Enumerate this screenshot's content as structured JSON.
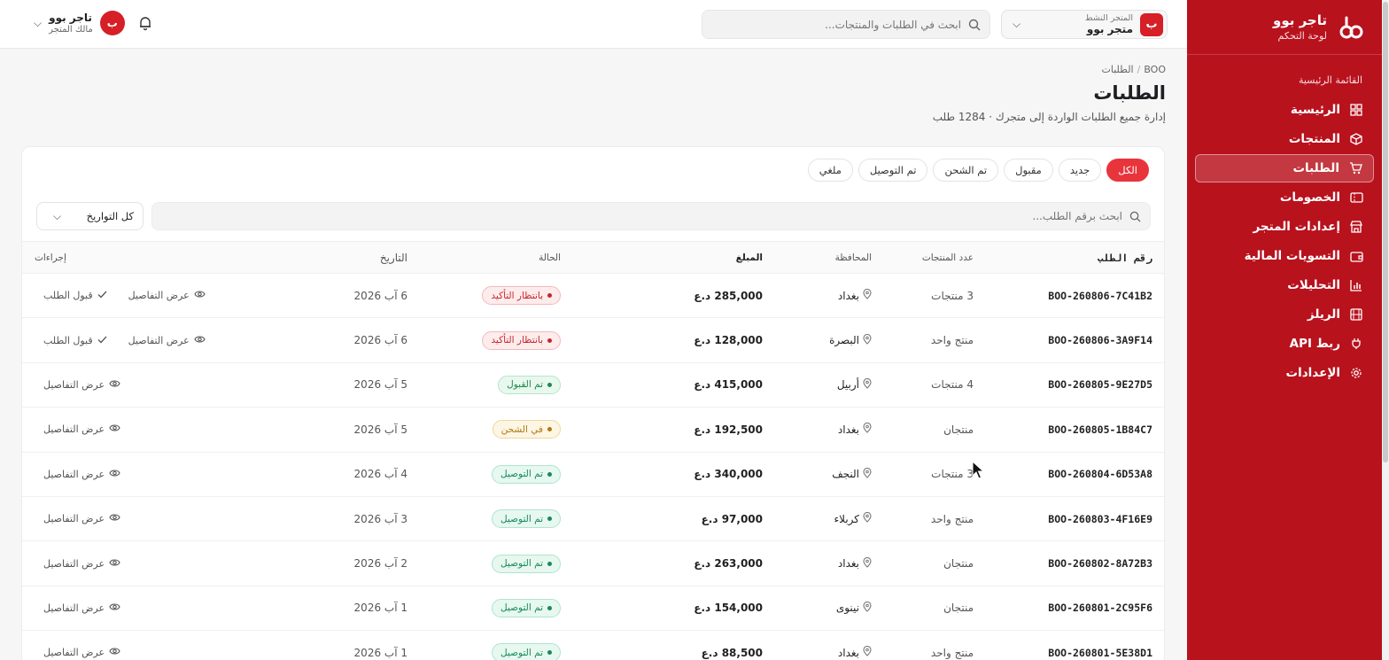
{
  "sidebar": {
    "brand_name": "تاجر بوو",
    "brand_sub": "لوحة التحكم",
    "section_label": "القائمة الرئيسية",
    "items": [
      {
        "label": "الرئيسية",
        "icon": "grid-icon"
      },
      {
        "label": "المنتجات",
        "icon": "box-icon"
      },
      {
        "label": "الطلبات",
        "icon": "cart-icon",
        "active": true
      },
      {
        "label": "الخصومات",
        "icon": "ticket-icon"
      },
      {
        "label": "إعدادات المتجر",
        "icon": "store-icon"
      },
      {
        "label": "التسويات المالية",
        "icon": "wallet-icon"
      },
      {
        "label": "التحليلات",
        "icon": "chart-icon"
      },
      {
        "label": "الريلز",
        "icon": "film-icon"
      },
      {
        "label": "ربط API",
        "icon": "plug-icon"
      },
      {
        "label": "الإعدادات",
        "icon": "gear-icon"
      }
    ]
  },
  "topbar": {
    "store_badge": "ب",
    "store_label": "المتجر النشط",
    "store_name": "متجر بوو",
    "search_placeholder": "ابحث في الطلبات والمنتجات...",
    "user_initial": "ب",
    "user_name": "تاجر بوو",
    "user_role": "مالك المتجر"
  },
  "page": {
    "breadcrumb_root": "BOO",
    "breadcrumb_current": "الطلبات",
    "title": "الطلبات",
    "description": "إدارة جميع الطلبات الواردة إلى متجرك · 1284 طلب"
  },
  "filters": {
    "tabs": [
      "الكل",
      "جديد",
      "مقبول",
      "تم الشحن",
      "تم التوصيل",
      "ملغي"
    ],
    "search_placeholder": "ابحث برقم الطلب...",
    "date_select": "كل التواريخ"
  },
  "table": {
    "headers": {
      "id": "رقم الطلب",
      "items": "عدد المنتجات",
      "governorate": "المحافظة",
      "amount": "المبلغ",
      "status": "الحالة",
      "date": "التاريخ",
      "actions": "إجراءات"
    },
    "actions": {
      "view": "عرض التفاصيل",
      "accept": "قبول الطلب"
    },
    "rows": [
      {
        "id": "BOO-260806-7C41B2",
        "items": "3 منتجات",
        "gov": "بغداد",
        "amount": "285,000 د.ع",
        "status": "بانتظار التأكيد",
        "status_type": "pending",
        "date": "6 آب 2026",
        "accept": true
      },
      {
        "id": "BOO-260806-3A9F14",
        "items": "منتج واحد",
        "gov": "البصرة",
        "amount": "128,000 د.ع",
        "status": "بانتظار التأكيد",
        "status_type": "pending",
        "date": "6 آب 2026",
        "accept": true
      },
      {
        "id": "BOO-260805-9E27D5",
        "items": "4 منتجات",
        "gov": "أربيل",
        "amount": "415,000 د.ع",
        "status": "تم القبول",
        "status_type": "accepted",
        "date": "5 آب 2026",
        "accept": false
      },
      {
        "id": "BOO-260805-1B84C7",
        "items": "منتجان",
        "gov": "بغداد",
        "amount": "192,500 د.ع",
        "status": "في الشحن",
        "status_type": "shipping",
        "date": "5 آب 2026",
        "accept": false
      },
      {
        "id": "BOO-260804-6D53A8",
        "items": "3 منتجات",
        "gov": "النجف",
        "amount": "340,000 د.ع",
        "status": "تم التوصيل",
        "status_type": "delivered",
        "date": "4 آب 2026",
        "accept": false
      },
      {
        "id": "BOO-260803-4F16E9",
        "items": "منتج واحد",
        "gov": "كربلاء",
        "amount": "97,000 د.ع",
        "status": "تم التوصيل",
        "status_type": "delivered",
        "date": "3 آب 2026",
        "accept": false
      },
      {
        "id": "BOO-260802-8A72B3",
        "items": "منتجان",
        "gov": "بغداد",
        "amount": "263,000 د.ع",
        "status": "تم التوصيل",
        "status_type": "delivered",
        "date": "2 آب 2026",
        "accept": false
      },
      {
        "id": "BOO-260801-2C95F6",
        "items": "منتجان",
        "gov": "نينوى",
        "amount": "154,000 د.ع",
        "status": "تم التوصيل",
        "status_type": "delivered",
        "date": "1 آب 2026",
        "accept": false
      },
      {
        "id": "BOO-260801-5E38D1",
        "items": "منتج واحد",
        "gov": "بغداد",
        "amount": "88,500 د.ع",
        "status": "تم التوصيل",
        "status_type": "delivered",
        "date": "1 آب 2026",
        "accept": false
      }
    ]
  },
  "colors": {
    "brand": "#b8121d",
    "accent": "#e8353c"
  }
}
